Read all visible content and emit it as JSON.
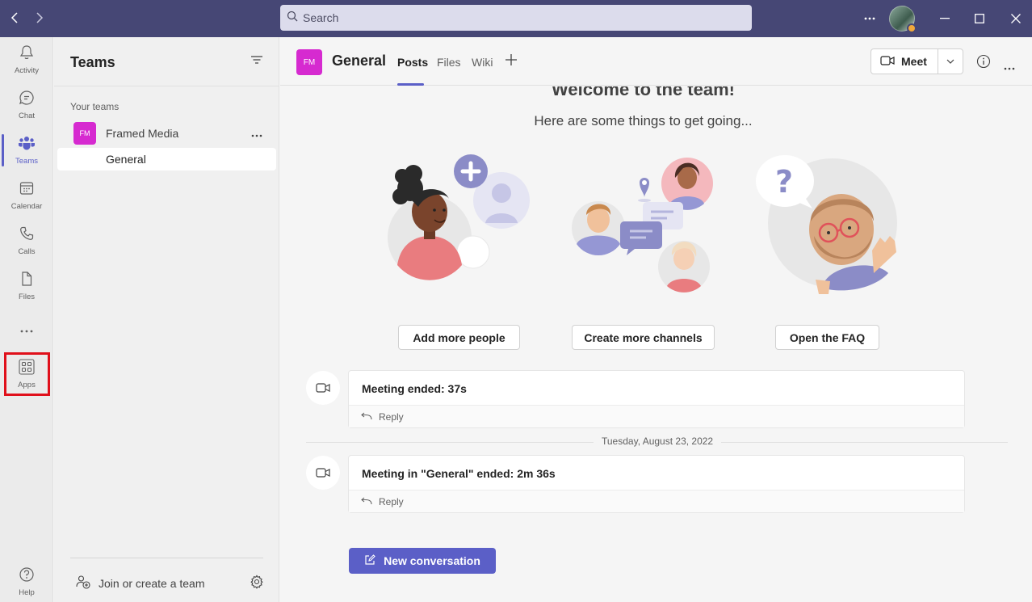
{
  "titlebar": {
    "search_placeholder": "Search",
    "more_label": "...",
    "user_status_color": "#f2a93b"
  },
  "rail": {
    "items": [
      {
        "label": "Activity",
        "icon": "bell-icon"
      },
      {
        "label": "Chat",
        "icon": "chat-icon"
      },
      {
        "label": "Teams",
        "icon": "teams-icon",
        "active": true
      },
      {
        "label": "Calendar",
        "icon": "calendar-icon"
      },
      {
        "label": "Calls",
        "icon": "phone-icon"
      },
      {
        "label": "Files",
        "icon": "file-icon"
      },
      {
        "label": "Apps",
        "icon": "apps-icon",
        "highlighted": true
      },
      {
        "label": "Help",
        "icon": "help-icon"
      }
    ],
    "more": "..."
  },
  "panel": {
    "title": "Teams",
    "section_label": "Your teams",
    "team": {
      "initials": "FM",
      "name": "Framed Media",
      "more": "..."
    },
    "channel": "General",
    "join_label": "Join or create a team"
  },
  "channel_header": {
    "initials": "FM",
    "name": "General",
    "tabs": [
      "Posts",
      "Files",
      "Wiki"
    ],
    "active_tab": "Posts",
    "meet_label": "Meet"
  },
  "welcome": {
    "title": "Welcome to the team!",
    "subtitle": "Here are some things to get going...",
    "actions": [
      "Add more people",
      "Create more channels",
      "Open the FAQ"
    ]
  },
  "messages": [
    {
      "text": "Meeting ended: 37s",
      "reply": "Reply"
    },
    {
      "text": "Meeting in \"General\" ended: 2m 36s",
      "reply": "Reply"
    }
  ],
  "date_separator": "Tuesday, August 23, 2022",
  "new_conversation_label": "New conversation",
  "colors": {
    "brand": "#5b5fc7",
    "titlebar": "#464775",
    "team_avatar": "#d62ad0",
    "highlight_box": "#e0101b"
  }
}
